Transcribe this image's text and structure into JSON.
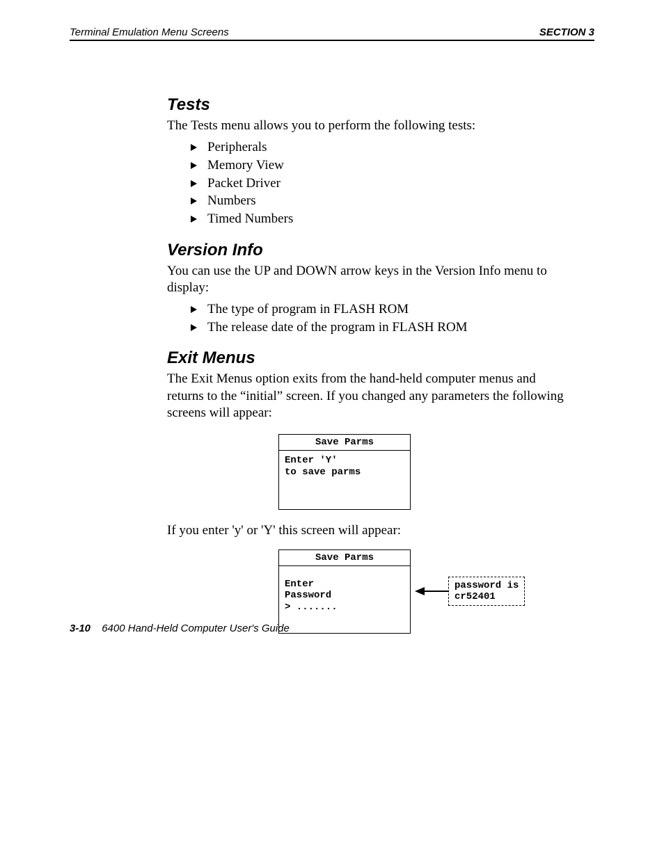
{
  "header": {
    "left": "Terminal Emulation Menu Screens",
    "right": "SECTION 3"
  },
  "sections": {
    "tests": {
      "title": "Tests",
      "intro": "The Tests menu allows you to perform the following tests:",
      "items": [
        "Peripherals",
        "Memory View",
        "Packet Driver",
        "Numbers",
        "Timed Numbers"
      ]
    },
    "version": {
      "title": "Version Info",
      "intro": "You can use the UP and DOWN arrow keys in the Version Info menu to display:",
      "items": [
        "The type of program in FLASH ROM",
        "The release date of the program in FLASH ROM"
      ]
    },
    "exit": {
      "title": "Exit Menus",
      "intro": "The Exit Menus option exits from the hand-held computer menus and returns to the “initial” screen. If you changed any parameters the following screens will appear:",
      "screen1": {
        "title": "Save Parms",
        "body": "Enter 'Y'\nto save parms"
      },
      "mid_text": "If you enter 'y' or 'Y' this screen will appear:",
      "screen2": {
        "title": "Save Parms",
        "body": "Enter\nPassword\n> ......."
      },
      "callout": "password is\ncr52401"
    }
  },
  "footer": {
    "pageno": "3-10",
    "title": "6400 Hand-Held Computer User's Guide"
  }
}
